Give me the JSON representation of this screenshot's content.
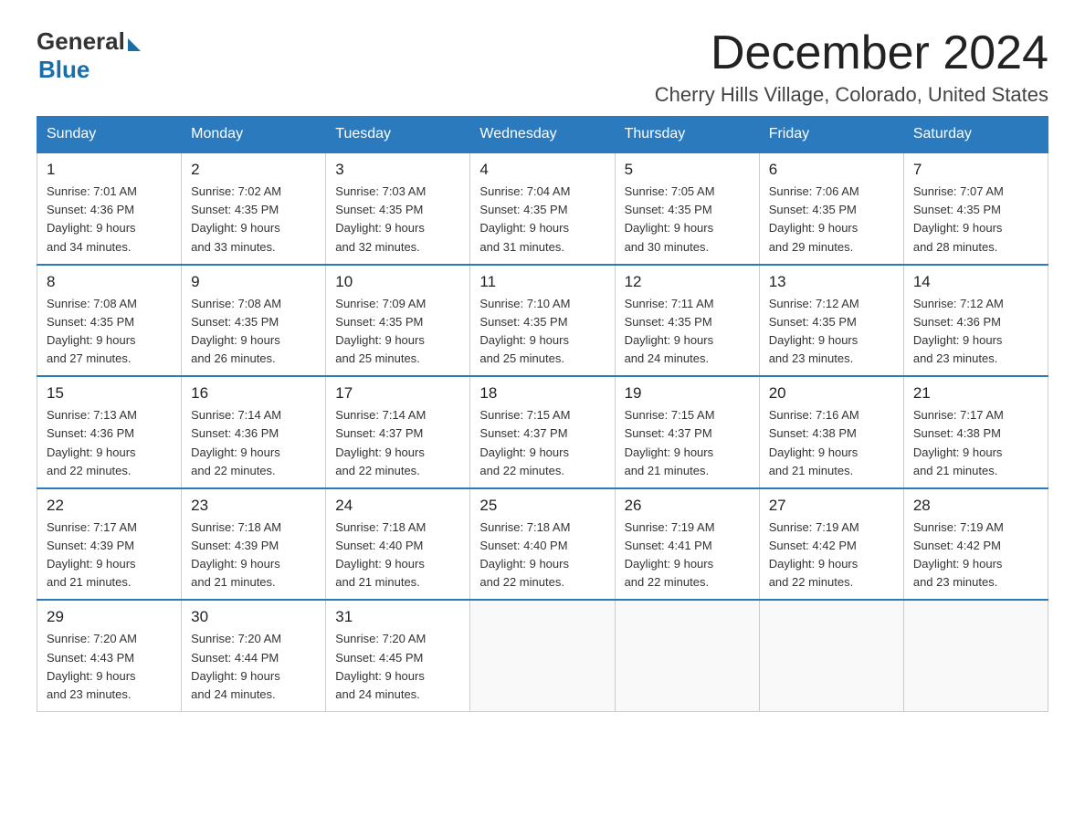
{
  "logo": {
    "general": "General",
    "blue": "Blue"
  },
  "title": "December 2024",
  "location": "Cherry Hills Village, Colorado, United States",
  "headers": [
    "Sunday",
    "Monday",
    "Tuesday",
    "Wednesday",
    "Thursday",
    "Friday",
    "Saturday"
  ],
  "weeks": [
    [
      {
        "day": "1",
        "info": "Sunrise: 7:01 AM\nSunset: 4:36 PM\nDaylight: 9 hours\nand 34 minutes."
      },
      {
        "day": "2",
        "info": "Sunrise: 7:02 AM\nSunset: 4:35 PM\nDaylight: 9 hours\nand 33 minutes."
      },
      {
        "day": "3",
        "info": "Sunrise: 7:03 AM\nSunset: 4:35 PM\nDaylight: 9 hours\nand 32 minutes."
      },
      {
        "day": "4",
        "info": "Sunrise: 7:04 AM\nSunset: 4:35 PM\nDaylight: 9 hours\nand 31 minutes."
      },
      {
        "day": "5",
        "info": "Sunrise: 7:05 AM\nSunset: 4:35 PM\nDaylight: 9 hours\nand 30 minutes."
      },
      {
        "day": "6",
        "info": "Sunrise: 7:06 AM\nSunset: 4:35 PM\nDaylight: 9 hours\nand 29 minutes."
      },
      {
        "day": "7",
        "info": "Sunrise: 7:07 AM\nSunset: 4:35 PM\nDaylight: 9 hours\nand 28 minutes."
      }
    ],
    [
      {
        "day": "8",
        "info": "Sunrise: 7:08 AM\nSunset: 4:35 PM\nDaylight: 9 hours\nand 27 minutes."
      },
      {
        "day": "9",
        "info": "Sunrise: 7:08 AM\nSunset: 4:35 PM\nDaylight: 9 hours\nand 26 minutes."
      },
      {
        "day": "10",
        "info": "Sunrise: 7:09 AM\nSunset: 4:35 PM\nDaylight: 9 hours\nand 25 minutes."
      },
      {
        "day": "11",
        "info": "Sunrise: 7:10 AM\nSunset: 4:35 PM\nDaylight: 9 hours\nand 25 minutes."
      },
      {
        "day": "12",
        "info": "Sunrise: 7:11 AM\nSunset: 4:35 PM\nDaylight: 9 hours\nand 24 minutes."
      },
      {
        "day": "13",
        "info": "Sunrise: 7:12 AM\nSunset: 4:35 PM\nDaylight: 9 hours\nand 23 minutes."
      },
      {
        "day": "14",
        "info": "Sunrise: 7:12 AM\nSunset: 4:36 PM\nDaylight: 9 hours\nand 23 minutes."
      }
    ],
    [
      {
        "day": "15",
        "info": "Sunrise: 7:13 AM\nSunset: 4:36 PM\nDaylight: 9 hours\nand 22 minutes."
      },
      {
        "day": "16",
        "info": "Sunrise: 7:14 AM\nSunset: 4:36 PM\nDaylight: 9 hours\nand 22 minutes."
      },
      {
        "day": "17",
        "info": "Sunrise: 7:14 AM\nSunset: 4:37 PM\nDaylight: 9 hours\nand 22 minutes."
      },
      {
        "day": "18",
        "info": "Sunrise: 7:15 AM\nSunset: 4:37 PM\nDaylight: 9 hours\nand 22 minutes."
      },
      {
        "day": "19",
        "info": "Sunrise: 7:15 AM\nSunset: 4:37 PM\nDaylight: 9 hours\nand 21 minutes."
      },
      {
        "day": "20",
        "info": "Sunrise: 7:16 AM\nSunset: 4:38 PM\nDaylight: 9 hours\nand 21 minutes."
      },
      {
        "day": "21",
        "info": "Sunrise: 7:17 AM\nSunset: 4:38 PM\nDaylight: 9 hours\nand 21 minutes."
      }
    ],
    [
      {
        "day": "22",
        "info": "Sunrise: 7:17 AM\nSunset: 4:39 PM\nDaylight: 9 hours\nand 21 minutes."
      },
      {
        "day": "23",
        "info": "Sunrise: 7:18 AM\nSunset: 4:39 PM\nDaylight: 9 hours\nand 21 minutes."
      },
      {
        "day": "24",
        "info": "Sunrise: 7:18 AM\nSunset: 4:40 PM\nDaylight: 9 hours\nand 21 minutes."
      },
      {
        "day": "25",
        "info": "Sunrise: 7:18 AM\nSunset: 4:40 PM\nDaylight: 9 hours\nand 22 minutes."
      },
      {
        "day": "26",
        "info": "Sunrise: 7:19 AM\nSunset: 4:41 PM\nDaylight: 9 hours\nand 22 minutes."
      },
      {
        "day": "27",
        "info": "Sunrise: 7:19 AM\nSunset: 4:42 PM\nDaylight: 9 hours\nand 22 minutes."
      },
      {
        "day": "28",
        "info": "Sunrise: 7:19 AM\nSunset: 4:42 PM\nDaylight: 9 hours\nand 23 minutes."
      }
    ],
    [
      {
        "day": "29",
        "info": "Sunrise: 7:20 AM\nSunset: 4:43 PM\nDaylight: 9 hours\nand 23 minutes."
      },
      {
        "day": "30",
        "info": "Sunrise: 7:20 AM\nSunset: 4:44 PM\nDaylight: 9 hours\nand 24 minutes."
      },
      {
        "day": "31",
        "info": "Sunrise: 7:20 AM\nSunset: 4:45 PM\nDaylight: 9 hours\nand 24 minutes."
      },
      {
        "day": "",
        "info": ""
      },
      {
        "day": "",
        "info": ""
      },
      {
        "day": "",
        "info": ""
      },
      {
        "day": "",
        "info": ""
      }
    ]
  ]
}
